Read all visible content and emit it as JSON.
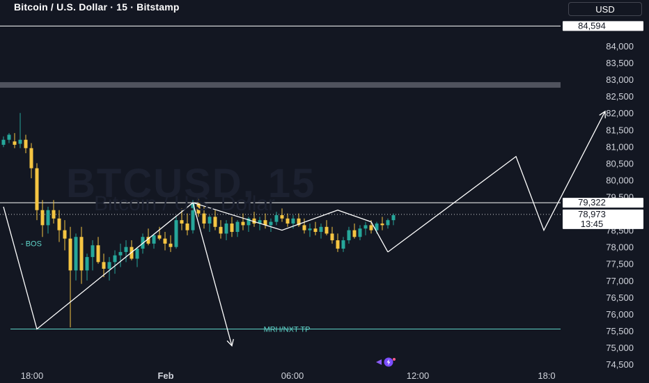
{
  "header": {
    "title": "Bitcoin / U.S. Dollar · 15 · Bitstamp",
    "currency": "USD"
  },
  "watermark": {
    "symbol": "BTCUSD, 15",
    "description": "Bitcoin / U.S. Dollar"
  },
  "colors": {
    "background": "#131722",
    "up": "#26a69a",
    "down": "#f5c542",
    "drawing": "#ffffff",
    "tp_line": "#5fd3c8",
    "axis_text": "#d1d4dc",
    "band": "#50535e",
    "brand": "#9c6bff"
  },
  "icons": {
    "brand": "lightning-bolt-icon"
  },
  "chart_data": {
    "type": "candlestick",
    "title": "Bitcoin / U.S. Dollar · 15 · Bitstamp",
    "ylim": [
      74500,
      84900
    ],
    "y_ticks": [
      74500,
      75000,
      75500,
      76000,
      76500,
      77000,
      77500,
      78000,
      78500,
      79000,
      79500,
      80000,
      80500,
      81000,
      81500,
      82000,
      82500,
      83000,
      83500,
      84000
    ],
    "x_ticks": [
      "18:00",
      "Feb",
      "06:00",
      "12:00",
      "18:0"
    ],
    "price_labels": [
      {
        "text": "84,594",
        "value": 84594
      },
      {
        "text": "79,322",
        "value": 79322
      },
      {
        "text": "78,973",
        "sub": "13:45",
        "value": 78973
      }
    ],
    "candles": [
      [
        81050,
        81300,
        80980,
        81200
      ],
      [
        81200,
        81400,
        81100,
        81350
      ],
      [
        81150,
        81400,
        80950,
        81050
      ],
      [
        81080,
        82000,
        80950,
        81200
      ],
      [
        81200,
        81350,
        80800,
        80950
      ],
      [
        80950,
        81100,
        80050,
        80350
      ],
      [
        80350,
        80500,
        78800,
        79100
      ],
      [
        79100,
        79400,
        78300,
        78650
      ],
      [
        78650,
        79200,
        78400,
        79100
      ],
      [
        79100,
        79400,
        78700,
        78850
      ],
      [
        78850,
        79100,
        78150,
        78500
      ],
      [
        78500,
        78800,
        77900,
        78250
      ],
      [
        78250,
        78600,
        75600,
        77300
      ],
      [
        77300,
        78400,
        77000,
        78300
      ],
      [
        78300,
        78600,
        76900,
        77300
      ],
      [
        77300,
        77800,
        77000,
        77700
      ],
      [
        77700,
        78200,
        77300,
        78050
      ],
      [
        78050,
        78300,
        77500,
        77550
      ],
      [
        77550,
        77800,
        77100,
        77350
      ],
      [
        77350,
        77700,
        77000,
        77550
      ],
      [
        77550,
        77900,
        77200,
        77750
      ],
      [
        77750,
        78100,
        77400,
        77850
      ],
      [
        77850,
        78200,
        77550,
        78000
      ],
      [
        78000,
        78200,
        77600,
        77650
      ],
      [
        77650,
        78000,
        77400,
        77950
      ],
      [
        77950,
        78400,
        77800,
        78300
      ],
      [
        78300,
        78550,
        78050,
        78100
      ],
      [
        78100,
        78400,
        77950,
        78350
      ],
      [
        78350,
        78600,
        78200,
        78250
      ],
      [
        78250,
        78450,
        77900,
        78100
      ],
      [
        78100,
        78350,
        77850,
        78000
      ],
      [
        78000,
        78900,
        77950,
        78800
      ],
      [
        78800,
        79150,
        78500,
        78700
      ],
      [
        78700,
        79000,
        78350,
        78500
      ],
      [
        78500,
        79400,
        78400,
        79300
      ],
      [
        79300,
        79550,
        78900,
        79000
      ],
      [
        79000,
        79200,
        78550,
        78700
      ],
      [
        78700,
        78950,
        78450,
        78900
      ],
      [
        78900,
        79100,
        78500,
        78600
      ],
      [
        78600,
        78800,
        78250,
        78400
      ],
      [
        78400,
        78800,
        78200,
        78700
      ],
      [
        78700,
        78900,
        78300,
        78450
      ],
      [
        78450,
        78800,
        78300,
        78750
      ],
      [
        78750,
        79000,
        78500,
        78650
      ],
      [
        78650,
        78900,
        78450,
        78850
      ],
      [
        78850,
        79050,
        78600,
        78700
      ],
      [
        78700,
        78900,
        78500,
        78800
      ],
      [
        78800,
        79000,
        78550,
        78650
      ],
      [
        78650,
        78850,
        78450,
        78750
      ],
      [
        78750,
        79050,
        78650,
        78950
      ],
      [
        78950,
        79150,
        78750,
        78850
      ],
      [
        78850,
        79000,
        78600,
        78700
      ],
      [
        78700,
        78950,
        78550,
        78850
      ],
      [
        78850,
        79000,
        78600,
        78650
      ],
      [
        78650,
        78850,
        78400,
        78500
      ],
      [
        78500,
        78700,
        78300,
        78550
      ],
      [
        78550,
        78750,
        78350,
        78450
      ],
      [
        78450,
        78700,
        78250,
        78600
      ],
      [
        78600,
        78800,
        78350,
        78400
      ],
      [
        78400,
        78600,
        78100,
        78200
      ],
      [
        78200,
        78400,
        77850,
        77950
      ],
      [
        77950,
        78300,
        77850,
        78200
      ],
      [
        78200,
        78600,
        78100,
        78500
      ],
      [
        78500,
        78700,
        78250,
        78300
      ],
      [
        78300,
        78650,
        78200,
        78550
      ],
      [
        78550,
        78750,
        78350,
        78650
      ],
      [
        78650,
        78800,
        78400,
        78500
      ],
      [
        78500,
        78750,
        78400,
        78700
      ],
      [
        78700,
        78900,
        78500,
        78650
      ],
      [
        78650,
        78850,
        78550,
        78800
      ],
      [
        78800,
        79000,
        78650,
        78950
      ]
    ],
    "horizontal_levels": [
      {
        "price": 84594,
        "color": "#ffffff",
        "style": "solid"
      },
      {
        "price": 79322,
        "color": "#ffffff",
        "style": "solid"
      },
      {
        "price": 78973,
        "color": "#ffffff",
        "style": "dotted"
      },
      {
        "price": 75550,
        "color": "#5fd3c8",
        "style": "solid",
        "label": "MRH/NXT TP"
      }
    ],
    "bos_label": {
      "text": "- BOS",
      "price": 78110
    },
    "zigzag_past": [
      {
        "bar": 0,
        "price": 79200
      },
      {
        "bar": 6,
        "price": 75550
      },
      {
        "bar": 34,
        "price": 79322
      },
      {
        "bar": 50,
        "price": 78500
      },
      {
        "bar": 60,
        "price": 79100
      },
      {
        "bar": 66,
        "price": 78750
      },
      {
        "bar": 69,
        "price": 77850
      }
    ],
    "zigzag_projection": [
      {
        "bar": 69,
        "price": 77850
      },
      {
        "bar": 92,
        "price": 80700
      },
      {
        "bar": 97,
        "price": 78500
      },
      {
        "bar": 108,
        "price": 82050
      }
    ],
    "down_arrow": [
      {
        "bar": 34,
        "price": 79322
      },
      {
        "bar": 41,
        "price": 75050
      }
    ]
  }
}
